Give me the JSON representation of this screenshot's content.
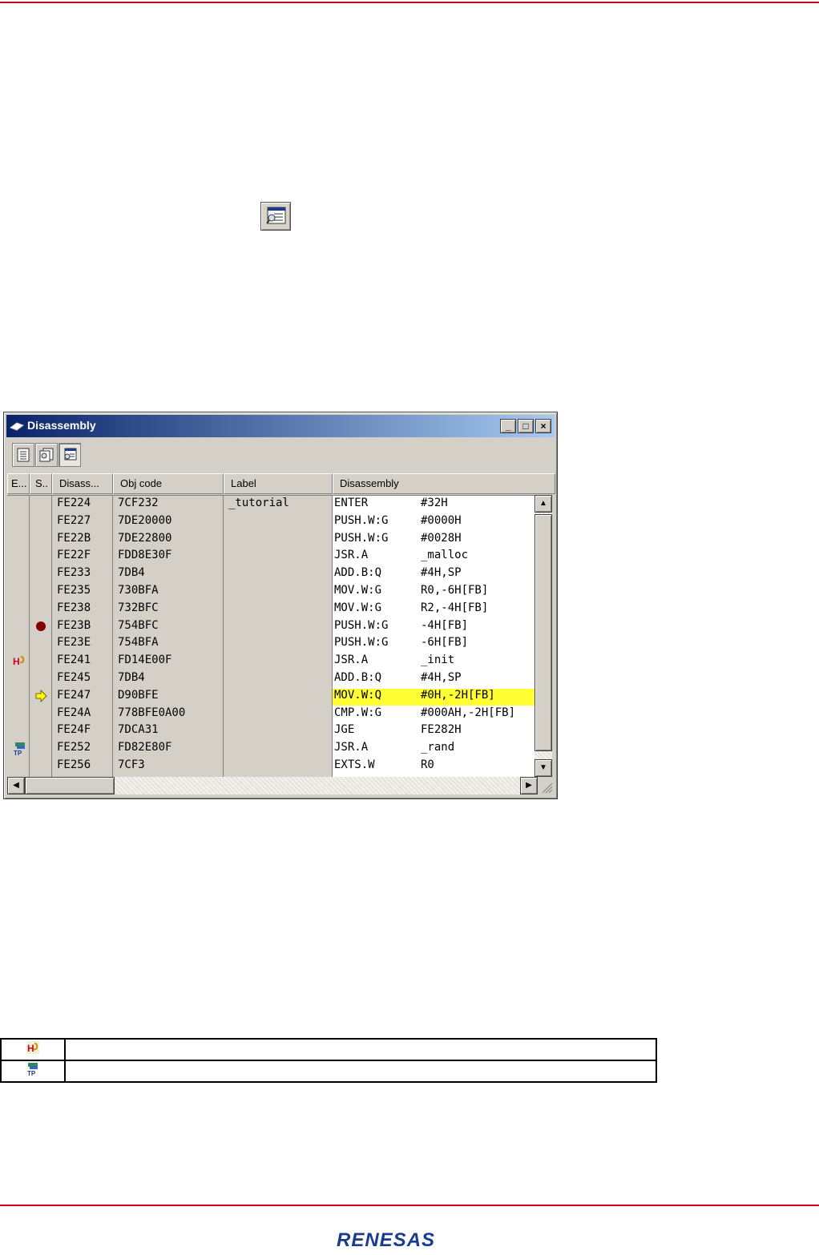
{
  "window": {
    "title": "Disassembly",
    "buttons": {
      "minimize": "_",
      "maximize": "□",
      "close": "×"
    }
  },
  "columns": [
    "E...",
    "S..",
    "Disass...",
    "Obj code",
    "Label",
    "Disassembly"
  ],
  "rows": [
    {
      "addr": "FE224",
      "obj": "7CF232",
      "label": "_tutorial",
      "mnemonic": "ENTER",
      "operand": "#32H",
      "marker": "",
      "highlight": false
    },
    {
      "addr": "FE227",
      "obj": "7DE20000",
      "label": "",
      "mnemonic": "PUSH.W:G",
      "operand": "#0000H",
      "marker": "",
      "highlight": false
    },
    {
      "addr": "FE22B",
      "obj": "7DE22800",
      "label": "",
      "mnemonic": "PUSH.W:G",
      "operand": "#0028H",
      "marker": "",
      "highlight": false
    },
    {
      "addr": "FE22F",
      "obj": "FDD8E30F",
      "label": "",
      "mnemonic": "JSR.A",
      "operand": "_malloc",
      "marker": "",
      "highlight": false
    },
    {
      "addr": "FE233",
      "obj": "7DB4",
      "label": "",
      "mnemonic": "ADD.B:Q",
      "operand": "#4H,SP",
      "marker": "",
      "highlight": false
    },
    {
      "addr": "FE235",
      "obj": "730BFA",
      "label": "",
      "mnemonic": "MOV.W:G",
      "operand": "R0,-6H[FB]",
      "marker": "",
      "highlight": false
    },
    {
      "addr": "FE238",
      "obj": "732BFC",
      "label": "",
      "mnemonic": "MOV.W:G",
      "operand": "R2,-4H[FB]",
      "marker": "",
      "highlight": false
    },
    {
      "addr": "FE23B",
      "obj": "754BFC",
      "label": "",
      "mnemonic": "PUSH.W:G",
      "operand": "-4H[FB]",
      "marker": "breakpoint-icon",
      "highlight": false
    },
    {
      "addr": "FE23E",
      "obj": "754BFA",
      "label": "",
      "mnemonic": "PUSH.W:G",
      "operand": "-6H[FB]",
      "marker": "",
      "highlight": false
    },
    {
      "addr": "FE241",
      "obj": "FD14E00F",
      "label": "",
      "mnemonic": "JSR.A",
      "operand": "_init",
      "marker": "hardware-break-icon",
      "highlight": false
    },
    {
      "addr": "FE245",
      "obj": "7DB4",
      "label": "",
      "mnemonic": "ADD.B:Q",
      "operand": "#4H,SP",
      "marker": "",
      "highlight": false
    },
    {
      "addr": "FE247",
      "obj": "D90BFE",
      "label": "",
      "mnemonic": "MOV.W:Q",
      "operand": "#0H,-2H[FB]",
      "marker": "pc-arrow-icon",
      "highlight": true
    },
    {
      "addr": "FE24A",
      "obj": "778BFE0A00",
      "label": "",
      "mnemonic": "CMP.W:G",
      "operand": "#000AH,-2H[FB]",
      "marker": "",
      "highlight": false
    },
    {
      "addr": "FE24F",
      "obj": "7DCA31",
      "label": "",
      "mnemonic": "JGE",
      "operand": "FE282H",
      "marker": "",
      "highlight": false
    },
    {
      "addr": "FE252",
      "obj": "FD82E80F",
      "label": "",
      "mnemonic": "JSR.A",
      "operand": "_rand",
      "marker": "trace-point-icon",
      "highlight": false
    },
    {
      "addr": "FE256",
      "obj": "7CF3",
      "label": "",
      "mnemonic": "EXTS.W",
      "operand": "R0",
      "marker": "",
      "highlight": false
    }
  ],
  "legend": [
    {
      "icon": "hardware-break-icon",
      "text": ""
    },
    {
      "icon": "trace-point-icon",
      "text": ""
    }
  ],
  "footer": {
    "brand": "RENESAS"
  },
  "colors": {
    "rule": "#d0021b",
    "highlight": "#ffff33",
    "titlebar": "#0a246a"
  }
}
